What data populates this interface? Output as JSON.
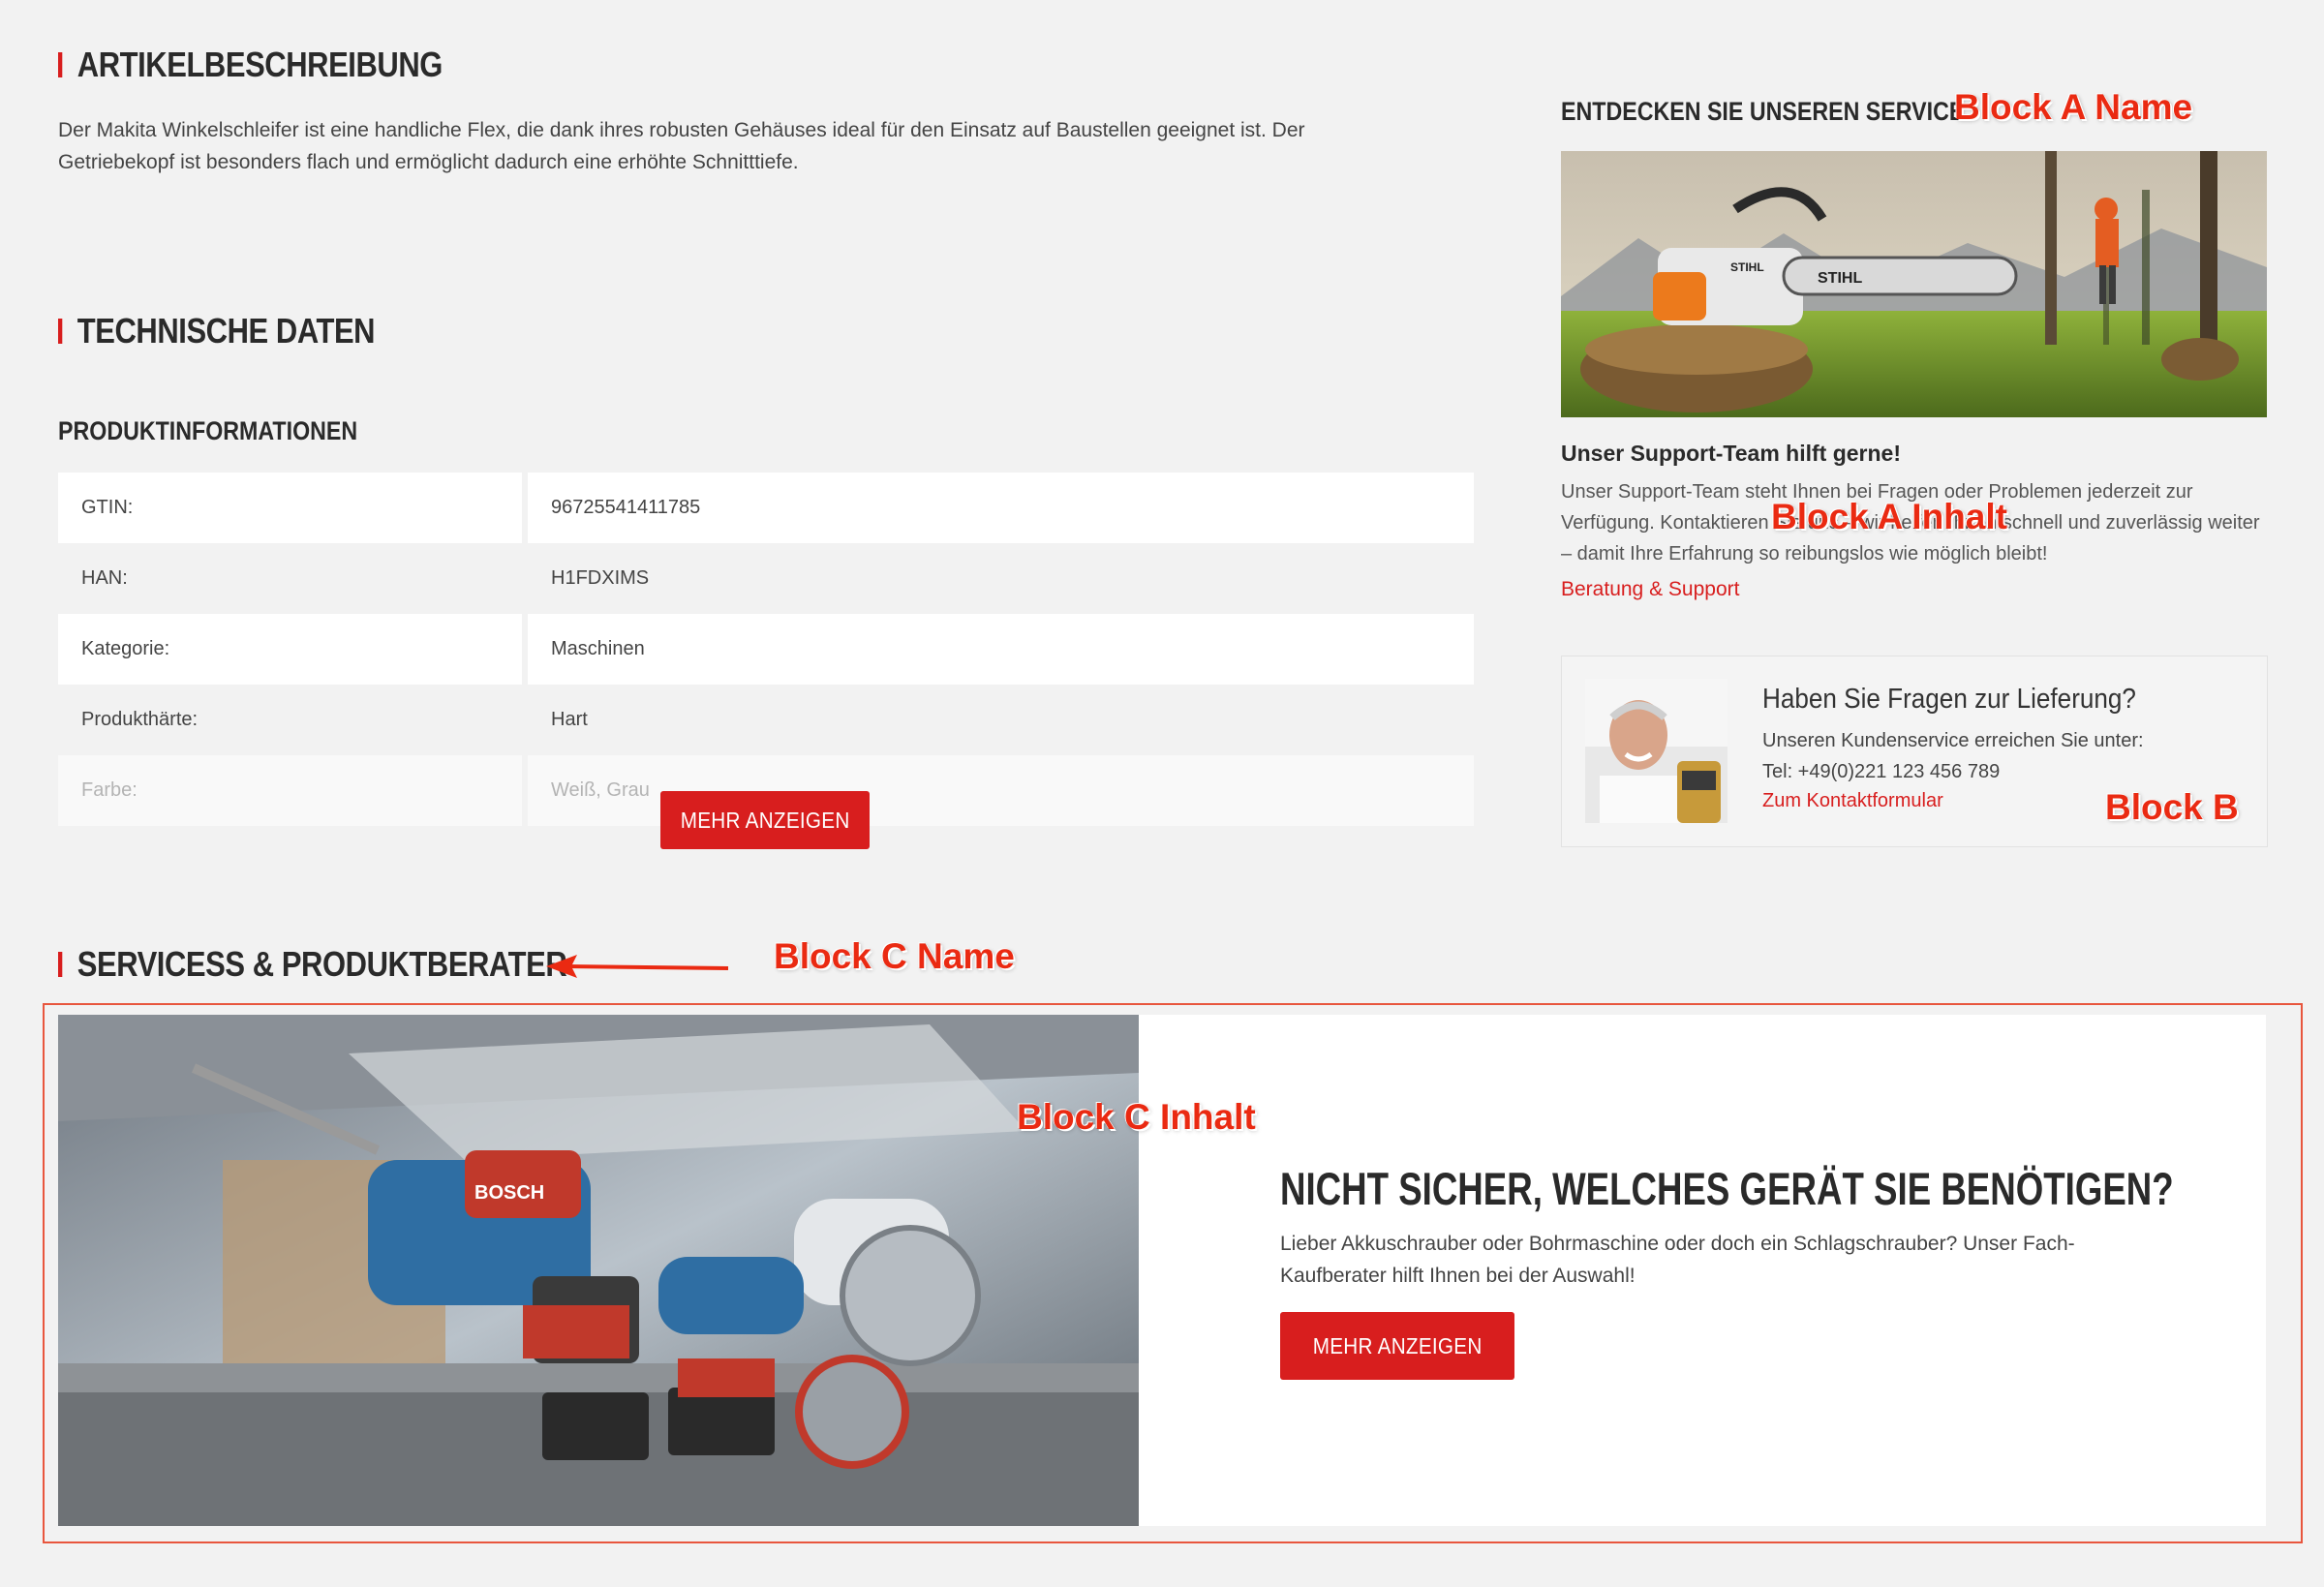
{
  "artikelbeschreibung": {
    "heading": "ARTIKELBESCHREIBUNG",
    "text": "Der Makita Winkelschleifer ist eine handliche Flex, die dank ihres robusten Gehäuses ideal für den Einsatz auf Baustellen geeignet ist. Der Getriebekopf ist besonders flach und ermöglicht dadurch eine erhöhte Schnitttiefe."
  },
  "technische_daten": {
    "heading": "TECHNISCHE DATEN",
    "subheading": "PRODUKTINFORMATIONEN",
    "rows": [
      {
        "label": "GTIN:",
        "value": "96725541411785"
      },
      {
        "label": "HAN:",
        "value": "H1FDXIMS"
      },
      {
        "label": "Kategorie:",
        "value": "Maschinen"
      },
      {
        "label": "Produkthärte:",
        "value": "Hart"
      },
      {
        "label": "Farbe:",
        "value": "Weiß, Grau"
      }
    ],
    "more_button": "MEHR ANZEIGEN"
  },
  "service": {
    "heading": "ENTDECKEN SIE UNSEREN SERVICE",
    "image_brand": "STIHL",
    "support_title": "Unser Support-Team hilft gerne!",
    "support_text": "Unser Support-Team steht Ihnen bei Fragen oder Problemen jederzeit zur Verfügung. Kontaktieren Sie uns – wir helfen Ihnen schnell und zuverlässig weiter – damit Ihre Erfahrung so reibungslos wie möglich bleibt!",
    "support_link": "Beratung & Support"
  },
  "lieferung": {
    "title": "Haben Sie Fragen zur Lieferung?",
    "line1": "Unseren Kundenservice erreichen Sie unter:",
    "phone": "Tel: +49(0)221 123 456 789",
    "link": "Zum Kontaktformular"
  },
  "produktberater": {
    "heading": "SERVICESS & PRODUKTBERATER",
    "title": "NICHT SICHER, WELCHES GERÄT SIE BENÖTIGEN?",
    "text": "Lieber Akkuschrauber oder Bohrmaschine oder doch ein Schlagschrauber? Unser Fach-Kaufberater hilft Ihnen bei der Auswahl!",
    "button": "MEHR ANZEIGEN",
    "image_brand": "BOSCH"
  },
  "annotations": {
    "block_a_name": "Block A Name",
    "block_a_inhalt": "Block A Inhalt",
    "block_b": "Block B",
    "block_c_name": "Block C Name",
    "block_c_inhalt": "Block C Inhalt"
  },
  "colors": {
    "accent": "#d81e1e",
    "annotation": "#ea2a12",
    "background": "#f2f2f2"
  }
}
